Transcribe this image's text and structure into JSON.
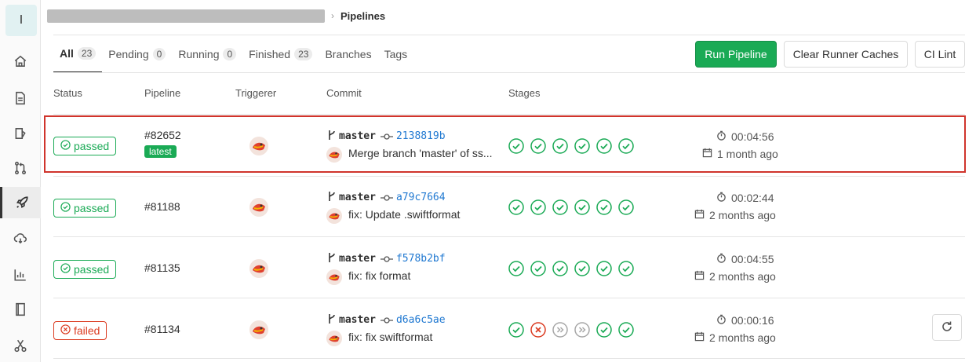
{
  "sidebar": {
    "project_initial": "I",
    "items": [
      {
        "name": "home-icon"
      },
      {
        "name": "document-icon"
      },
      {
        "name": "issues-icon"
      },
      {
        "name": "merge-request-icon"
      },
      {
        "name": "rocket-icon"
      },
      {
        "name": "cloud-icon"
      },
      {
        "name": "chart-icon"
      },
      {
        "name": "book-icon"
      },
      {
        "name": "scissors-icon"
      }
    ]
  },
  "breadcrumb": {
    "current": "Pipelines"
  },
  "tabs": [
    {
      "label": "All",
      "count": "23"
    },
    {
      "label": "Pending",
      "count": "0"
    },
    {
      "label": "Running",
      "count": "0"
    },
    {
      "label": "Finished",
      "count": "23"
    },
    {
      "label": "Branches",
      "count": ""
    },
    {
      "label": "Tags",
      "count": ""
    }
  ],
  "actions": {
    "run_pipeline": "Run Pipeline",
    "clear_caches": "Clear Runner Caches",
    "ci_lint": "CI Lint"
  },
  "columns": [
    "Status",
    "Pipeline",
    "Triggerer",
    "Commit",
    "Stages"
  ],
  "pipelines": [
    {
      "status": "passed",
      "id": "#82652",
      "badge": "latest",
      "branch": "master",
      "sha": "2138819b",
      "message": "Merge branch 'master' of ss...",
      "stages": [
        "success",
        "success",
        "success",
        "success",
        "success",
        "success"
      ],
      "duration": "00:04:56",
      "finished": "1 month ago"
    },
    {
      "status": "passed",
      "id": "#81188",
      "badge": "",
      "branch": "master",
      "sha": "a79c7664",
      "message": "fix: Update .swiftformat",
      "stages": [
        "success",
        "success",
        "success",
        "success",
        "success",
        "success"
      ],
      "duration": "00:02:44",
      "finished": "2 months ago"
    },
    {
      "status": "passed",
      "id": "#81135",
      "badge": "",
      "branch": "master",
      "sha": "f578b2bf",
      "message": "fix: fix format",
      "stages": [
        "success",
        "success",
        "success",
        "success",
        "success",
        "success"
      ],
      "duration": "00:04:55",
      "finished": "2 months ago"
    },
    {
      "status": "failed",
      "id": "#81134",
      "badge": "",
      "branch": "master",
      "sha": "d6a6c5ae",
      "message": "fix: fix swiftformat",
      "stages": [
        "success",
        "failed",
        "skipped",
        "skipped",
        "success",
        "success"
      ],
      "duration": "00:00:16",
      "finished": "2 months ago"
    }
  ],
  "colors": {
    "success": "#1aaa55",
    "failed": "#db3b21",
    "skipped": "#a7a7a7",
    "link": "#1f78d1"
  }
}
